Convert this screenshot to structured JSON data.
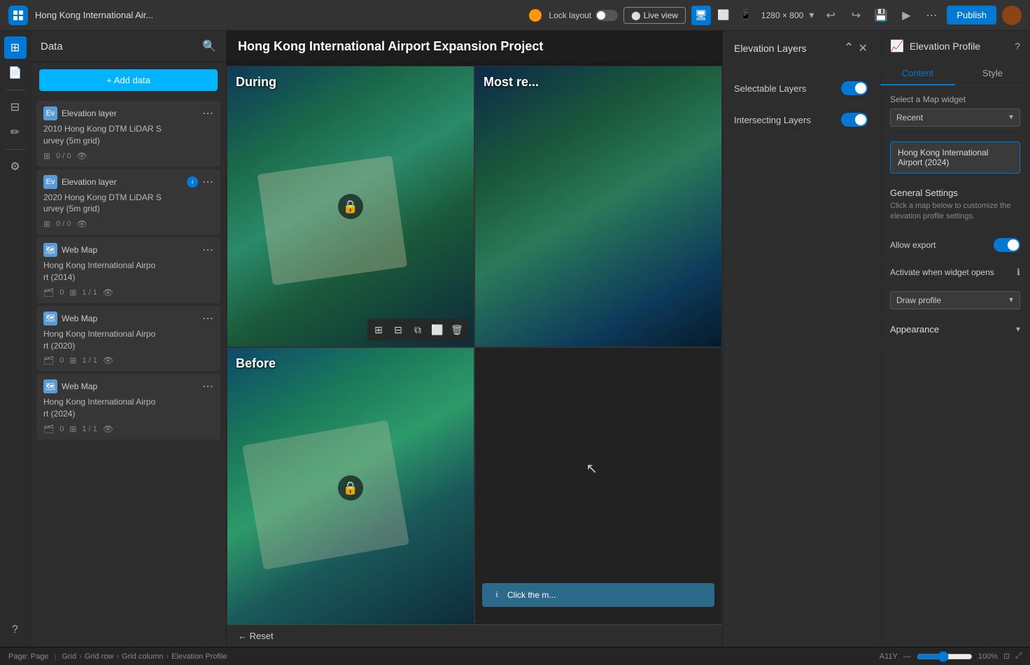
{
  "app": {
    "title": "Hong Kong International Air...",
    "badge_color": "#f90"
  },
  "topbar": {
    "lock_layout_label": "Lock layout",
    "live_view_label": "Live view",
    "resolution": "1280 × 800",
    "publish_label": "Publish"
  },
  "sidebar": {
    "title": "Data",
    "add_data_label": "+ Add data",
    "items": [
      {
        "type": "elevation",
        "label": "Elevation layer",
        "name": "2010 Hong Kong DTM LiDAR Survey (5m grid)",
        "meta": "0 / 0",
        "has_badge": false
      },
      {
        "type": "elevation",
        "label": "Elevation layer",
        "name": "2020 Hong Kong DTM LiDAR Survey (5m grid)",
        "meta": "0 / 0",
        "has_badge": true
      },
      {
        "type": "map",
        "label": "Web Map",
        "name": "Hong Kong International Airport (2014)",
        "meta": "0",
        "meta2": "1 / 1",
        "has_badge": false
      },
      {
        "type": "map",
        "label": "Web Map",
        "name": "Hong Kong International Airport (2020)",
        "meta": "0",
        "meta2": "1 / 1",
        "has_badge": false
      },
      {
        "type": "map",
        "label": "Web Map",
        "name": "Hong Kong International Airport (2024)",
        "meta": "0",
        "meta2": "1 / 1",
        "has_badge": false
      }
    ]
  },
  "canvas": {
    "main_title": "Hong Kong International Airport Expansion Project",
    "maps": [
      {
        "label": "During",
        "position": "top-left"
      },
      {
        "label": "Most re...",
        "position": "top-right"
      },
      {
        "label": "Before",
        "position": "bottom-left"
      },
      {
        "label": "",
        "position": "bottom-right"
      }
    ],
    "click_message": "Click the m...",
    "reset_label": "← Reset"
  },
  "elev_panel": {
    "title": "Elevation Layers",
    "selectable_layers_label": "Selectable Layers",
    "selectable_layers_on": true,
    "intersecting_layers_label": "Intersecting Layers",
    "intersecting_layers_on": true
  },
  "right_panel": {
    "title": "Elevation Profile",
    "tab_content": "Content",
    "tab_style": "Style",
    "select_map_widget_label": "Select a Map widget",
    "select_map_value": "Recent",
    "map_card_title": "Hong Kong International Airport (2024)",
    "general_settings_title": "General Settings",
    "general_settings_desc": "Click a map below to customize the elevation profile settings.",
    "allow_export_label": "Allow export",
    "allow_export_on": true,
    "activate_label": "Activate when widget opens",
    "activate_dropdown_label": "Draw profile",
    "appearance_label": "Appearance"
  },
  "bottombar": {
    "page_label": "Page: Page",
    "breadcrumb": [
      "Grid",
      "Grid row",
      "Grid column",
      "Elevation Profile"
    ],
    "accessibility": "A11Y",
    "zoom": "100%"
  }
}
